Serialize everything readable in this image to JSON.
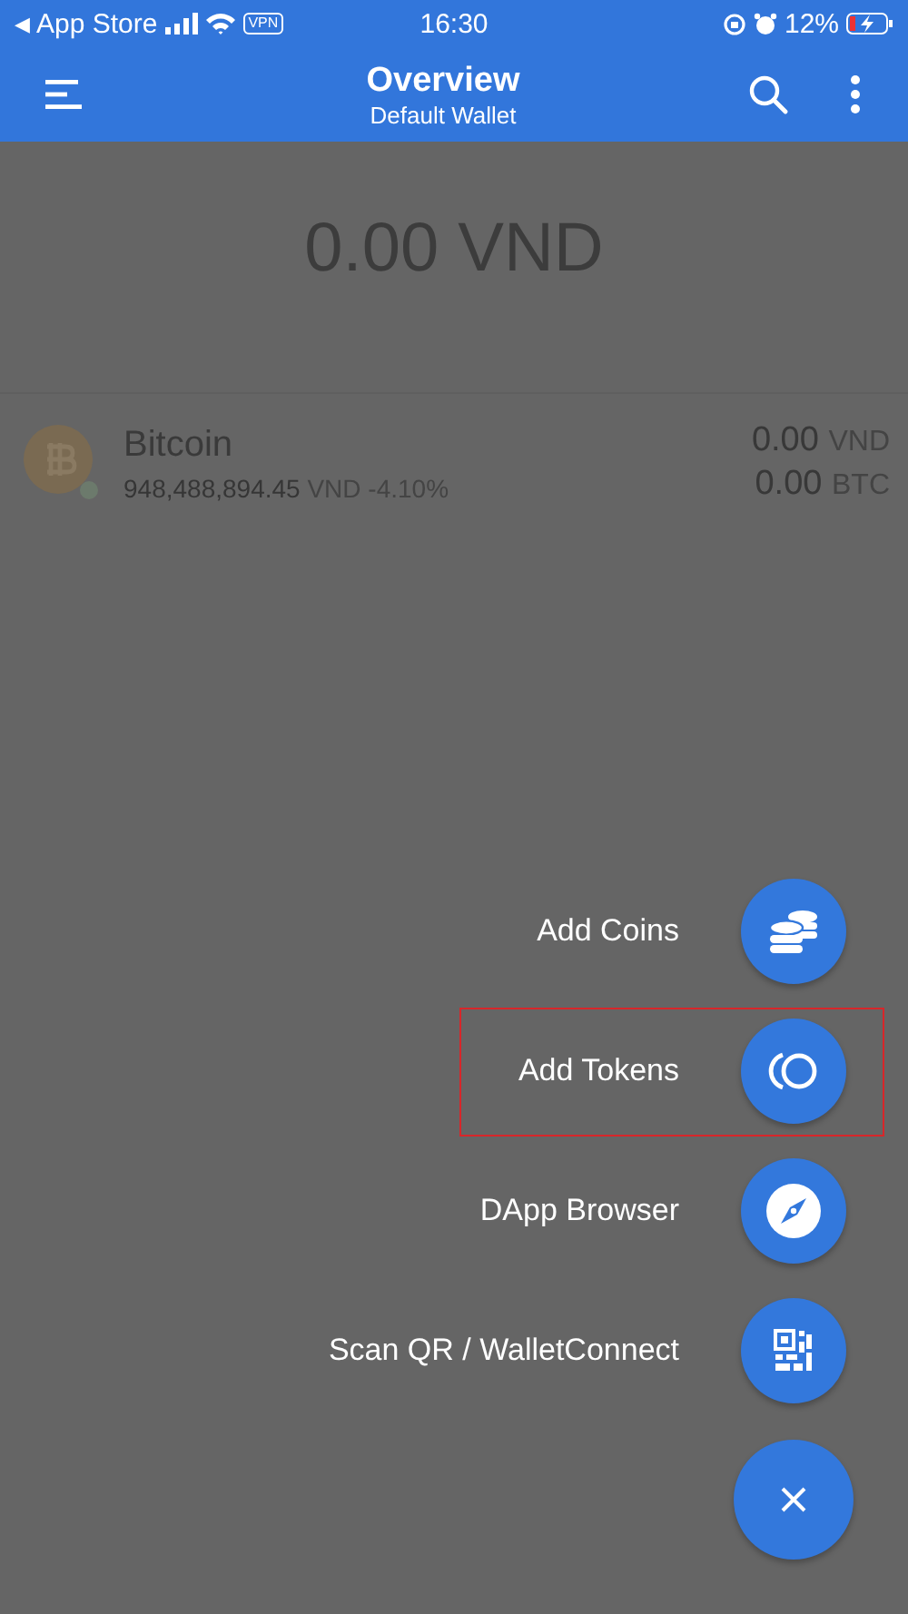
{
  "status_bar": {
    "back_arrow": "◀",
    "back_label": "App Store",
    "vpn": "VPN",
    "time": "16:30",
    "battery_percent": "12%",
    "charging": true
  },
  "app_bar": {
    "title": "Overview",
    "subtitle": "Default Wallet"
  },
  "balance": "0.00 VND",
  "assets": [
    {
      "name": "Bitcoin",
      "price": "948,488,894.45",
      "price_currency": "VND",
      "change": "-4.10%",
      "fiat_value": "0.00",
      "fiat_currency": "VND",
      "amount": "0.00",
      "symbol": "BTC"
    }
  ],
  "menu": {
    "actions": [
      {
        "label": "Add Coins",
        "kind": "coins",
        "highlighted": false
      },
      {
        "label": "Add Tokens",
        "kind": "tokens",
        "highlighted": true
      },
      {
        "label": "DApp Browser",
        "kind": "browser",
        "highlighted": false
      },
      {
        "label": "Scan QR / WalletConnect",
        "kind": "scan",
        "highlighted": false
      }
    ]
  }
}
